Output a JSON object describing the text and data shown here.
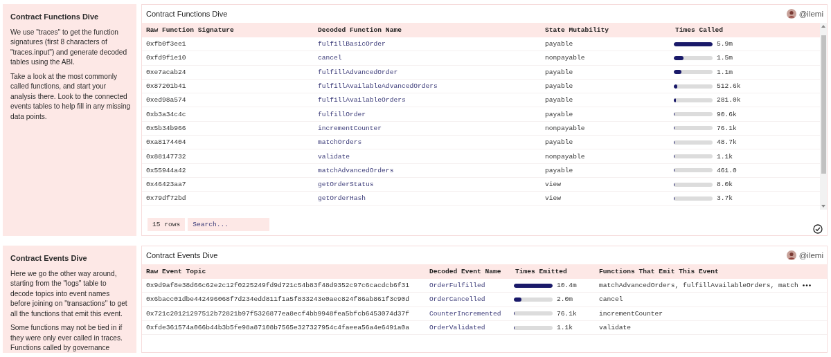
{
  "sections": [
    {
      "kind": "functions",
      "notes": {
        "title": "Contract Functions Dive",
        "paragraphs": [
          "We use \"traces\" to get the function signatures (first 8 characters of \"traces.input\") and generate decoded tables using the ABI.",
          "Take a look at the most commonly called functions, and start your analysis there. Look to the connected events tables to help fill in any missing data points."
        ]
      },
      "card": {
        "title": "Contract Functions Dive",
        "user": "@ilemi",
        "columns": [
          {
            "label": "Raw Function Signature",
            "kind": "text"
          },
          {
            "label": "Decoded Function Name",
            "kind": "link"
          },
          {
            "label": "State Mutability",
            "kind": "text"
          },
          {
            "label": "Times Called",
            "kind": "bar"
          }
        ],
        "rows": [
          {
            "values": [
              "0xfb0f3ee1",
              "fulfillBasicOrder",
              "payable",
              "5.9m"
            ],
            "level": 1
          },
          {
            "values": [
              "0xfd9f1e10",
              "cancel",
              "nonpayable",
              "1.5m"
            ],
            "level": 0.25
          },
          {
            "values": [
              "0xe7acab24",
              "fulfillAdvancedOrder",
              "payable",
              "1.1m"
            ],
            "level": 0.19
          },
          {
            "values": [
              "0x87201b41",
              "fulfillAvailableAdvancedOrders",
              "payable",
              "512.6k"
            ],
            "level": 0.087
          },
          {
            "values": [
              "0xed98a574",
              "fulfillAvailableOrders",
              "payable",
              "281.0k"
            ],
            "level": 0.048
          },
          {
            "values": [
              "0xb3a34c4c",
              "fulfillOrder",
              "payable",
              "90.6k"
            ],
            "level": 0.015
          },
          {
            "values": [
              "0x5b34b966",
              "incrementCounter",
              "nonpayable",
              "76.1k"
            ],
            "level": 0.013
          },
          {
            "values": [
              "0xa8174404",
              "matchOrders",
              "payable",
              "48.7k"
            ],
            "level": 0.008
          },
          {
            "values": [
              "0x88147732",
              "validate",
              "nonpayable",
              "1.1k"
            ],
            "level": 0.0002
          },
          {
            "values": [
              "0x55944a42",
              "matchAdvancedOrders",
              "payable",
              "461.0"
            ],
            "level": 0.0001
          },
          {
            "values": [
              "0x46423aa7",
              "getOrderStatus",
              "view",
              "8.0k"
            ],
            "level": 0.0014
          },
          {
            "values": [
              "0x79df72bd",
              "getOrderHash",
              "view",
              "3.7k"
            ],
            "level": 0.0006
          }
        ],
        "footer": {
          "row_count": "15 rows",
          "search_placeholder": "Search..."
        }
      }
    },
    {
      "kind": "events",
      "notes": {
        "title": "Contract Events Dive",
        "paragraphs": [
          "Here we go the other way around, starting from the \"logs\" table to decode topics into event names before joining on \"transactions\" to get all the functions that emit this event.",
          "Some functions may not be tied in if they were only ever called in traces. Functions called by governance"
        ]
      },
      "card": {
        "title": "Contract Events Dive",
        "user": "@ilemi",
        "columns": [
          {
            "label": "Raw Event Topic",
            "kind": "text"
          },
          {
            "label": "Decoded Event Name",
            "kind": "link"
          },
          {
            "label": "Times Emitted",
            "kind": "bar"
          },
          {
            "label": "Functions That Emit This Event",
            "kind": "text"
          }
        ],
        "rows": [
          {
            "values": [
              "0x9d9af8e38d66c62e2c12f0225249fd9d721c54b83f48d9352c97c6cacdcb6f31",
              "OrderFulfilled",
              "10.4m",
              "matchAdvancedOrders, fulfillAvailableOrders, match"
            ],
            "level": 1,
            "overflow": true
          },
          {
            "values": [
              "0x6bacc01dbe442496068f7d234edd811f1a5f833243e0aec824f86ab861f3c90d",
              "OrderCancelled",
              "2.0m",
              "cancel"
            ],
            "level": 0.19,
            "overflow": false
          },
          {
            "values": [
              "0x721c20121297512b72821b97f5326877ea8ecf4bb9948fea5bfcb6453074d37f",
              "CounterIncremented",
              "76.1k",
              "incrementCounter"
            ],
            "level": 0.007,
            "overflow": false
          },
          {
            "values": [
              "0xfde361574a066b44b3b5fe98a87108b7565e327327954c4faeea56a4e6491a0a",
              "OrderValidated",
              "1.1k",
              "validate"
            ],
            "level": 0.0001,
            "overflow": false
          }
        ]
      }
    }
  ]
}
